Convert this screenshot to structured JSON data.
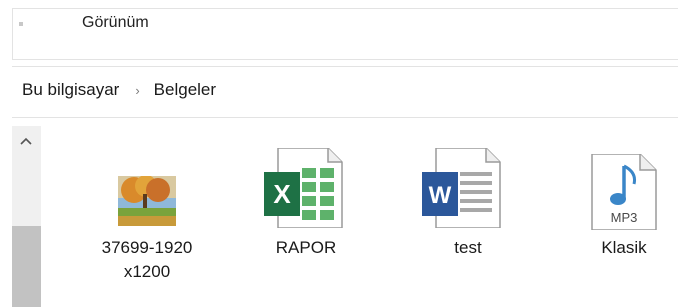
{
  "ribbon": {
    "tab_label": "Görünüm"
  },
  "breadcrumb": {
    "root": "Bu bilgisayar",
    "separator": "›",
    "current": "Belgeler"
  },
  "files": [
    {
      "name_line1": "37699-1920",
      "name_line2": "x1200",
      "icon": "image-thumbnail-icon"
    },
    {
      "name": "RAPOR",
      "icon": "excel-file-icon"
    },
    {
      "name": "test",
      "icon": "word-file-icon"
    },
    {
      "name": "Klasik",
      "icon": "mp3-file-icon",
      "badge": "MP3"
    }
  ],
  "colors": {
    "excel": "#1e7145",
    "word": "#2b579a",
    "mp3": "#3a86c8"
  }
}
